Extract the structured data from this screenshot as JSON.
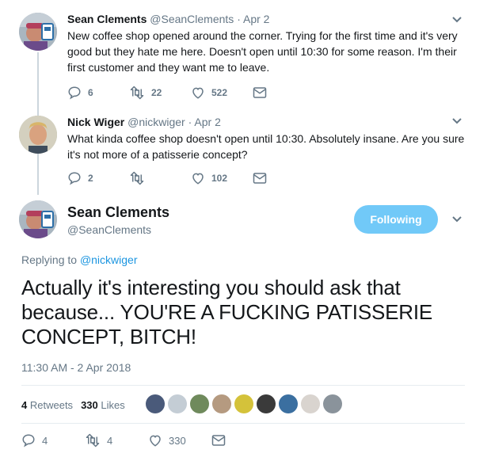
{
  "tweets": [
    {
      "name": "Sean Clements",
      "handle": "@SeanClements",
      "date": "Apr 2",
      "text": "New coffee shop opened around the corner. Trying for the first time and it's very good but they hate me here. Doesn't open until 10:30 for some reason. I'm their first customer and they want me to leave.",
      "replies": "6",
      "retweets": "22",
      "likes": "522"
    },
    {
      "name": "Nick Wiger",
      "handle": "@nickwiger",
      "date": "Apr 2",
      "text": "What kinda coffee shop doesn't open until 10:30. Absolutely insane. Are you sure it's not more of a patisserie concept?",
      "replies": "2",
      "retweets": "",
      "likes": "102"
    }
  ],
  "main": {
    "name": "Sean Clements",
    "handle": "@SeanClements",
    "follow_label": "Following",
    "replying_prefix": "Replying to",
    "replying_to": "@nickwiger",
    "text": "Actually it's interesting you should ask that because... YOU'RE A FUCKING PATISSERIE CONCEPT, BITCH!",
    "timestamp": "11:30 AM - 2 Apr 2018",
    "retweet_count": "4",
    "retweet_label": "Retweets",
    "like_count": "330",
    "like_label": "Likes",
    "replies": "4",
    "retweets": "4",
    "likes": "330"
  },
  "colors": {
    "accent": "#1b95e0",
    "follow_bg": "#71c9f8",
    "muted": "#657786",
    "thread_line": "#ccd6dd"
  },
  "icons": [
    "reply-icon",
    "retweet-icon",
    "like-icon",
    "dm-icon",
    "chevron-down-icon"
  ]
}
